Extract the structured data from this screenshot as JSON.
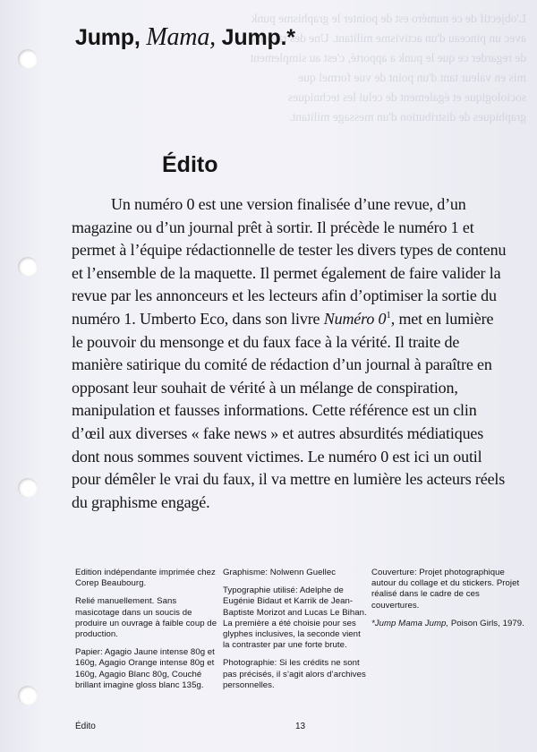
{
  "header": {
    "title_part1": "Jump,",
    "title_italic": "Mama,",
    "title_part2": "Jump.*"
  },
  "section": {
    "heading": "Édito"
  },
  "article": {
    "para_before_italic": "Un numéro 0 est une version finalisée d’une revue, d’un magazine ou d’un journal prêt à sortir. Il précède le numéro 1 et permet à l’équipe rédactionnelle de tester les divers types de contenu et l’ensemble de la maquette. Il permet également de faire valider la revue par les annonceurs et les lecteurs afin d’optimiser la sortie du numéro 1. Umberto Eco, dans son livre",
    "book_title": "Numéro 0",
    "footnote_marker": "1",
    "para_after_italic": ", met en lumière le pouvoir du mensonge et du faux face à la vérité. Il traite de manière satirique du comité de rédaction d’un journal à paraître en opposant leur souhait de vérité à un mélange de conspiration, manipulation et fausses informations. Cette référence est un clin d’œil aux diverses « fake news » et autres absurdités médiatiques dont nous sommes souvent victimes. Le numéro 0 est ici un outil pour démêler le vrai du faux, il va mettre en lumière les acteurs réels du graphisme engagé."
  },
  "colophon": {
    "col1": [
      "Edition indépendante imprimée chez Corep Beaubourg.",
      "Relié manuellement. Sans masicotage dans un soucis de produire un ouvrage à faible coup de production.",
      "Papier: Agagio Jaune intense 80g et 160g, Agagio Orange intense 80g et 160g, Agagio Blanc 80g, Couché brillant imagine gloss blanc 135g."
    ],
    "col2": [
      "Graphisme: Nolwenn Guellec",
      "Typographie utilisé: Adelphe de Eugénie Bidaut et Karrik de Jean-Baptiste Morizot and Lucas Le Bihan. La première a été choisie pour ses glyphes inclusives, la seconde vient la contraster par une forte brute.",
      "Photographie: Si les crédits ne sont pas précisés, il s’agit alors d’archives personnelles."
    ],
    "col3": [
      "Couverture: Projet photographique autour du collage et du stickers. Projet réalisé dans le cadre de ces couvertures."
    ],
    "col3_note_italic": "*Jump Mama Jump,",
    "col3_note_rest": "Poison Girls, 1979."
  },
  "footer": {
    "section_name": "Édito",
    "page_number": "13"
  },
  "colors": {
    "paper": "#eeeef6",
    "ink": "#151515"
  }
}
